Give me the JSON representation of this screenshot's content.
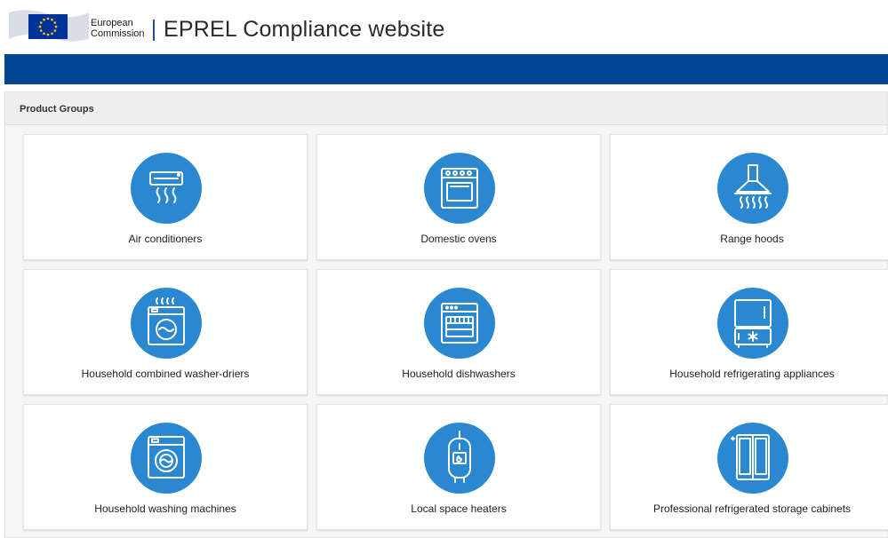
{
  "header": {
    "commission_line1": "European",
    "commission_line2": "Commission",
    "site_title": "EPREL Compliance website"
  },
  "panel": {
    "title": "Product Groups"
  },
  "product_groups": [
    {
      "label": "Air conditioners",
      "icon": "air-conditioner-icon"
    },
    {
      "label": "Domestic ovens",
      "icon": "oven-icon"
    },
    {
      "label": "Range hoods",
      "icon": "range-hood-icon"
    },
    {
      "label": "Household combined washer-driers",
      "icon": "washer-drier-icon"
    },
    {
      "label": "Household dishwashers",
      "icon": "dishwasher-icon"
    },
    {
      "label": "Household refrigerating appliances",
      "icon": "refrigerator-icon"
    },
    {
      "label": "Household washing machines",
      "icon": "washing-machine-icon"
    },
    {
      "label": "Local space heaters",
      "icon": "space-heater-icon"
    },
    {
      "label": "Professional refrigerated storage cabinets",
      "icon": "refrigerated-cabinet-icon"
    }
  ],
  "colors": {
    "brand_blue": "#004494",
    "icon_circle": "#2a88d0",
    "eu_flag": "#003399",
    "eu_star": "#ffcc00"
  }
}
